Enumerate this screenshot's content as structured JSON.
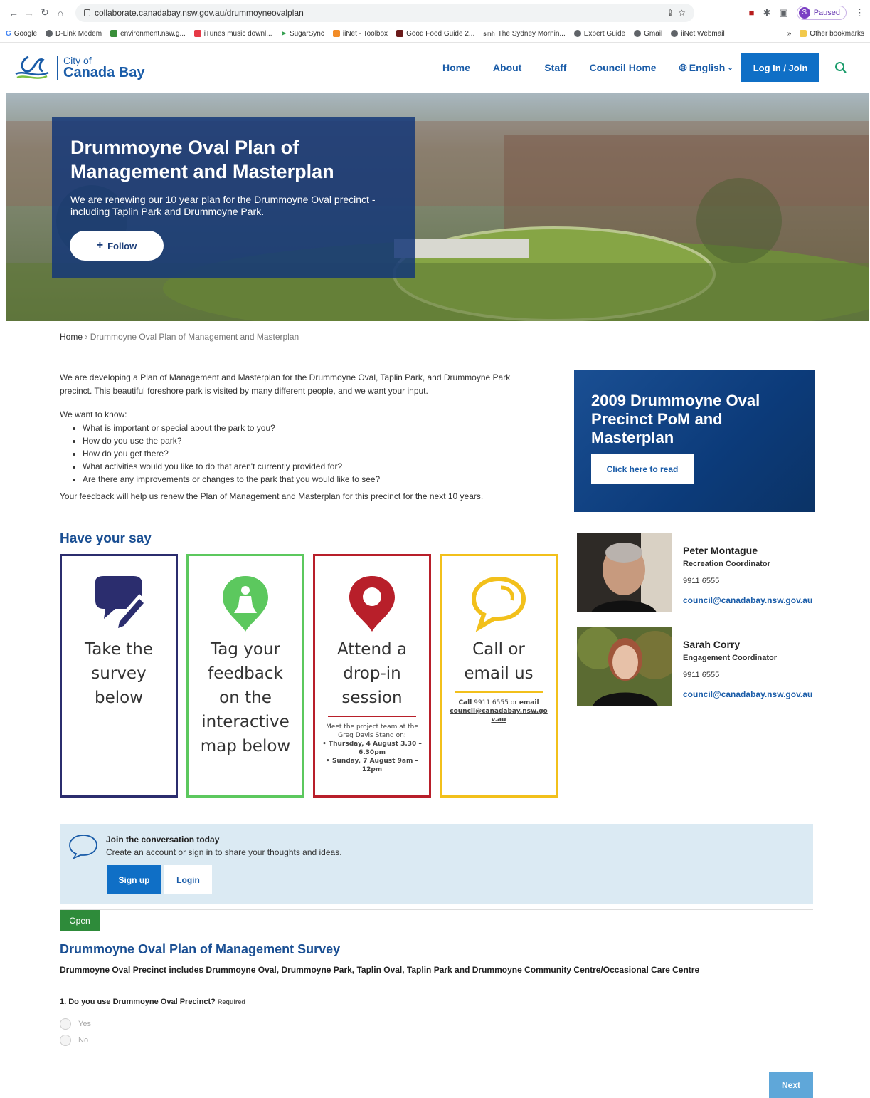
{
  "browser": {
    "url": "collaborate.canadabay.nsw.gov.au/drummoyneovalplan",
    "profile_status": "Paused",
    "profile_initial": "S",
    "bookmarks": [
      "Google",
      "D-Link Modem",
      "environment.nsw.g...",
      "iTunes music downl...",
      "iiNet - Toolbox",
      "SugarSync",
      "Good Food Guide 2...",
      "The Sydney Mornin...",
      "Expert Guide",
      "Gmail",
      "iiNet Webmail"
    ],
    "other_bookmarks": "Other bookmarks"
  },
  "header": {
    "logo_line1": "City of",
    "logo_line2": "Canada Bay",
    "nav": [
      "Home",
      "About",
      "Staff",
      "Council Home"
    ],
    "language": "English",
    "login_label": "Log In / Join"
  },
  "hero": {
    "title": "Drummoyne Oval Plan of Management and Masterplan",
    "subtitle": "We are renewing our 10 year plan for the Drummoyne Oval precinct - including Taplin Park and Drummoyne Park.",
    "follow_label": "Follow"
  },
  "breadcrumb": {
    "home": "Home",
    "current": "Drummoyne Oval Plan of Management and Masterplan"
  },
  "intro": {
    "p1": "We are developing a Plan of Management and Masterplan for the Drummoyne Oval, Taplin Park, and Drummoyne Park precinct. This beautiful foreshore park is visited by many different people, and we want your input.",
    "lead": "We want to know:",
    "items": [
      "What is important or special about the park to you?",
      "How do you use the park?",
      "How do you get there?",
      "What activities would you like to do that aren't currently provided for?",
      "Are there any improvements or changes to the park that you would like to see?"
    ],
    "p2": "Your feedback will help us renew the Plan of Management and Masterplan for this precinct for the next 10 years."
  },
  "side_card": {
    "title": "2009 Drummoyne Oval Precinct PoM and Masterplan",
    "button": "Click here to read"
  },
  "have_your_say": {
    "heading": "Have your say",
    "cards": [
      {
        "lines": [
          "Take the",
          "survey",
          "below"
        ],
        "color": "#2b2d6e"
      },
      {
        "lines": [
          "Tag your",
          "feedback",
          "on the",
          "interactive",
          "map below"
        ],
        "color": "#5cc85e"
      },
      {
        "lines": [
          "Attend a",
          "drop-in",
          "session"
        ],
        "color": "#b81f2a",
        "note_intro": "Meet the project team at the Greg Davis Stand on:",
        "sessions": [
          "Thursday, 4 August 3.30 – 6.30pm",
          "Sunday, 7 August 9am – 12pm"
        ]
      },
      {
        "lines": [
          "Call or",
          "email us"
        ],
        "color": "#f2c01b",
        "note_call": "Call",
        "note_phone": "9911 6555",
        "note_or": "or",
        "note_email_word": "email",
        "note_email": "council@canadabay.nsw.gov.au"
      }
    ]
  },
  "contacts": [
    {
      "name": "Peter Montague",
      "role": "Recreation Coordinator",
      "phone": "9911 6555",
      "email": "council@canadabay.nsw.gov.au"
    },
    {
      "name": "Sarah Corry",
      "role": "Engagement Coordinator",
      "phone": "9911 6555",
      "email": "council@canadabay.nsw.gov.au"
    }
  ],
  "join": {
    "title": "Join the conversation today",
    "text": "Create an account or sign in to share your thoughts and ideas.",
    "signup": "Sign up",
    "login": "Login"
  },
  "survey": {
    "status": "Open",
    "title": "Drummoyne Oval Plan of Management Survey",
    "description": "Drummoyne Oval Precinct includes Drummoyne Oval, Drummoyne Park, Taplin Oval, Taplin Park and Drummoyne Community Centre/Occasional Care Centre",
    "q1": "1. Do you use Drummoyne Oval Precinct?",
    "required": "Required",
    "options": [
      "Yes",
      "No"
    ],
    "next": "Next"
  }
}
